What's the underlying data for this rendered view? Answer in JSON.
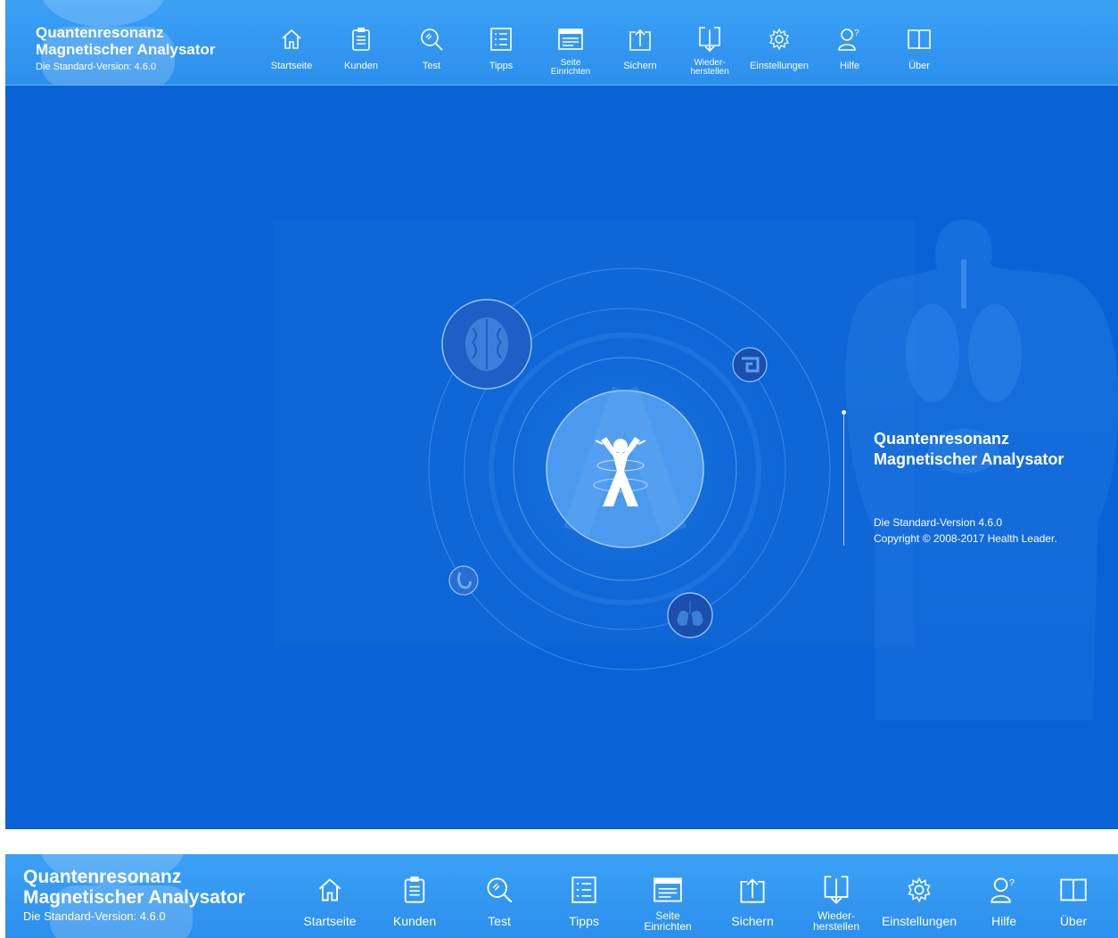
{
  "app": {
    "title_line1": "Quantenresonanz",
    "title_line2": "Magnetischer Analysator",
    "version_label": "Die Standard-Version: 4.6.0"
  },
  "nav": [
    {
      "id": "startseite",
      "label": "Startseite",
      "icon": "home-icon"
    },
    {
      "id": "kunden",
      "label": "Kunden",
      "icon": "clipboard-icon"
    },
    {
      "id": "test",
      "label": "Test",
      "icon": "magnifier-icon"
    },
    {
      "id": "tipps",
      "label": "Tipps",
      "icon": "list-icon"
    },
    {
      "id": "seite-einrichten",
      "label_line1": "Seite",
      "label_line2": "Einrichten",
      "icon": "page-setup-icon"
    },
    {
      "id": "sichern",
      "label": "Sichern",
      "icon": "upload-icon"
    },
    {
      "id": "wiederherstellen",
      "label_line1": "Wieder-",
      "label_line2": "herstellen",
      "icon": "download-icon"
    },
    {
      "id": "einstellungen",
      "label": "Einstellungen",
      "icon": "gear-icon"
    },
    {
      "id": "hilfe",
      "label": "Hilfe",
      "icon": "help-person-icon"
    },
    {
      "id": "ueber",
      "label": "Über",
      "icon": "book-icon"
    }
  ],
  "splash": {
    "title_line1": "Quantenresonanz",
    "title_line2": "Magnetischer Analysator",
    "version": "Die Standard-Version 4.6.0",
    "copyright": "Copyright © 2008-2017 Health Leader."
  },
  "colors": {
    "toolbar": "#2c8fee",
    "background": "#0a63d6",
    "text": "#ffffff"
  }
}
